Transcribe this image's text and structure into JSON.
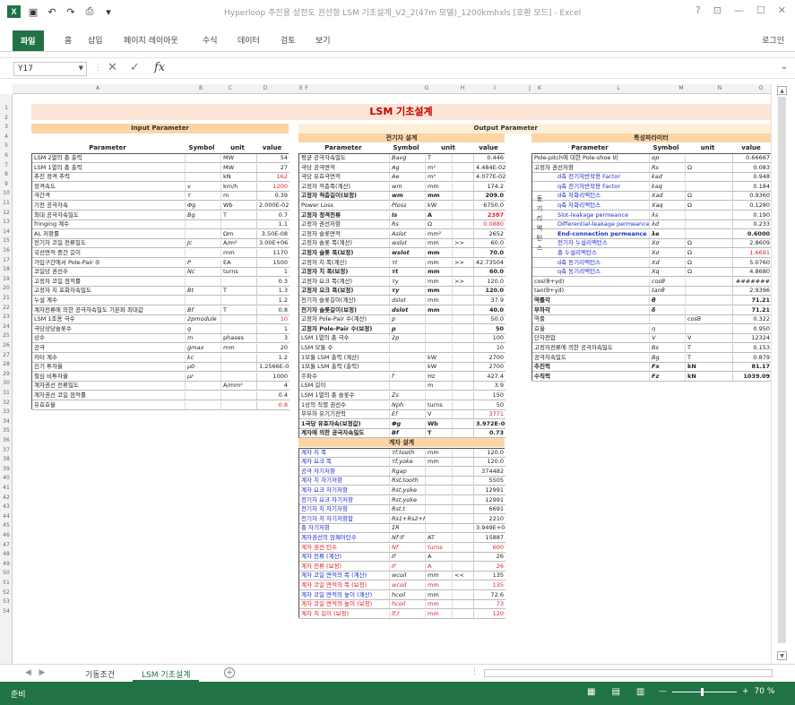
{
  "window": {
    "title": "Hyperloop 추진용 상전도 권선형 LSM 기초설계_V2_2(47m 모델)_1200kmhxls [호환 모드] - Excel",
    "controls": [
      "?",
      "⊡",
      "—",
      "☐",
      "✕"
    ]
  },
  "quick_access": {
    "icons": [
      "save-icon",
      "undo-icon",
      "redo-icon",
      "print-preview-icon",
      "customize-icon"
    ]
  },
  "ribbon": {
    "tabs": [
      "파일",
      "홈",
      "삽입",
      "페이지 레이아웃",
      "수식",
      "데이터",
      "검토",
      "보기"
    ],
    "login": "로그인"
  },
  "formula_bar": {
    "name_box": "Y17",
    "formula": ""
  },
  "sheet": {
    "col_letters": [
      "A",
      "B",
      "C",
      "D",
      "E",
      "F",
      "G",
      "H",
      "I",
      "J",
      "K",
      "L",
      "M",
      "N",
      "O"
    ],
    "title": "LSM 기초설계",
    "input_header": "Input Parameter",
    "output_header": "Output Parameter",
    "elec_header": "전기자 설계",
    "char_header": "특성파라미터",
    "field_header": "계자 설계",
    "col_heads": {
      "param": "Parameter",
      "symbol": "Symbol",
      "unit": "unit",
      "value": "value"
    },
    "vertical_label": [
      "동",
      "기",
      "리",
      "액",
      "턴",
      "스"
    ],
    "input_rows": [
      [
        "LSM 2열의 총 출력",
        "",
        "MW",
        "54"
      ],
      [
        "LSM 1열의 총 출력",
        "",
        "MW",
        "27"
      ],
      [
        "추진 정격 추력",
        "",
        "kN",
        "162"
      ],
      [
        "정격속도",
        "v",
        "km/h",
        "1200"
      ],
      [
        "극간격",
        "τ",
        "m",
        "0.39"
      ],
      [
        "기전 공극자속",
        "Φg",
        "Wb",
        "2.000E-02"
      ],
      [
        "최대 공극자속밀도",
        "Bg",
        "T",
        "0.7"
      ],
      [
        "fringing 계수",
        "",
        "",
        "1.1"
      ],
      [
        "AL 저항률",
        "",
        "Ωm",
        "3.50E-08"
      ],
      [
        "전기자 코일 전류밀도",
        "Jc",
        "A/m²",
        "3.00E+06"
      ],
      [
        "국선면적 중간 길이",
        "",
        "mm",
        "1170"
      ],
      [
        "가입구간에서 Pole-Pair 수",
        "P",
        "EA",
        "1500"
      ],
      [
        "코일당 권선수",
        "Nc",
        "turns",
        "1"
      ],
      [
        "고정자 코일 점적률",
        "",
        "",
        "0.3"
      ],
      [
        "고정자 치 포화자속밀도",
        "Bt",
        "T",
        "1.3"
      ],
      [
        "누설 계수",
        "",
        "",
        "1.2"
      ],
      [
        "계자전류에 의한 공극자속밀도 기본파 최대값",
        "Bf",
        "T",
        "0.8"
      ],
      [
        "LSM 1조용 극수",
        "2pmodule",
        "",
        "10"
      ],
      [
        "극당상당슬롯수",
        "q",
        "",
        "1"
      ],
      [
        "상수",
        "m",
        "phases",
        "3"
      ],
      [
        "공극",
        "gmax",
        "mm",
        "20"
      ],
      [
        "카터 계수",
        "kc",
        "",
        "1.2"
      ],
      [
        "진기 투자율",
        "μ0",
        "",
        "1.2566E-06"
      ],
      [
        "철심 비투자율",
        "μr",
        "",
        "1000"
      ],
      [
        "계자권선 전류밀도",
        "",
        "A/mm²",
        "4"
      ],
      [
        "계자권선 코일 점적률",
        "",
        "",
        "0.4"
      ],
      [
        "유효효율",
        "",
        "",
        "0.8"
      ]
    ],
    "input_red_rows": [
      2,
      3,
      17,
      26
    ],
    "output_rows": [
      [
        "평균 공극자속밀도",
        "Bavg",
        "T",
        "",
        "0.446"
      ],
      [
        "극당 공극면적",
        "Ag",
        "m²",
        "",
        "4.484E-02"
      ],
      [
        "극당 유효극면적",
        "Ae",
        "m²",
        "",
        "4.077E-02"
      ],
      [
        "고정자 적층폭(계산)",
        "wm",
        "mm",
        "",
        "174.2"
      ],
      [
        "고정자 적층길이(보정)",
        "wm",
        "mm",
        "",
        "209.0"
      ],
      [
        "Power Loss",
        "Ploss",
        "kW",
        "",
        "6750.0"
      ],
      [
        "고정자 정격전류",
        "Is",
        "A",
        "",
        "2387"
      ],
      [
        "고정자 권선저항",
        "Rs",
        "Ω",
        "",
        "0.0880"
      ],
      [
        "고정자 슬롯면적",
        "Aslot",
        "mm²",
        "",
        "2652"
      ],
      [
        "고정자 슬롯 폭(계산)",
        "wslot",
        "mm",
        ">>",
        "60.0"
      ],
      [
        "고정자 슬롯 폭(보정)",
        "wslot",
        "mm",
        "",
        "70.0"
      ],
      [
        "고정자 치 폭(계산)",
        "τt",
        "mm",
        ">>",
        "42.73504"
      ],
      [
        "고정자 치 폭(보정)",
        "τt",
        "mm",
        "",
        "60.0"
      ],
      [
        "고정자 요크 폭(계산)",
        "τy",
        "mm",
        ">>",
        "120.0"
      ],
      [
        "고정자 요크 폭(보정)",
        "τy",
        "mm",
        "",
        "120.0"
      ],
      [
        "전기자 슬롯길이(계산)",
        "dslot",
        "mm",
        "",
        "37.9"
      ],
      [
        "전기자 슬롯길이(보정)",
        "dslot",
        "mm",
        "",
        "40.0"
      ],
      [
        "고정자 Pole-Pair 수(계산)",
        "p",
        "",
        "",
        "50.0"
      ],
      [
        "고정자 Pole-Pair 수(보정)",
        "p",
        "",
        "",
        "50"
      ],
      [
        "LSM 1열의 총 극수",
        "2p",
        "",
        "",
        "100"
      ],
      [
        "LSM 모듈 수",
        "",
        "",
        "",
        "10"
      ],
      [
        "1모듈 LSM 출력 (계산)",
        "",
        "kW",
        "",
        "2700"
      ],
      [
        "1모듈 LSM 출력 (출력)",
        "",
        "kW",
        "",
        "2700"
      ],
      [
        "주파수",
        "f",
        "Hz",
        "",
        "427.4"
      ],
      [
        "LSM 길이",
        "",
        "m",
        "",
        "3.9"
      ],
      [
        "LSM 1열의 총 슬롯수",
        "Zs",
        "",
        "",
        "150"
      ],
      [
        "1상의 직렬 권선수",
        "Nph",
        "turns",
        "",
        "50"
      ],
      [
        "무부하 유기기전력",
        "Ef",
        "V",
        "",
        "3771"
      ],
      [
        "1극당 유효자속(보정값)",
        "Φg",
        "Wb",
        "",
        "3.972E-02"
      ],
      [
        "계자에 의한 공극자속밀도",
        "Bf",
        "T",
        "",
        "0.73"
      ]
    ],
    "output_bold_rows": [
      4,
      6,
      10,
      12,
      14,
      16,
      18,
      28,
      29
    ],
    "output_red_rows": [
      6,
      7,
      27
    ],
    "field_rows": [
      [
        "계자 치 폭",
        "τf,tooth",
        "mm",
        "",
        "120.0"
      ],
      [
        "계자 요크 폭",
        "τf,yoke",
        "mm",
        "",
        "120.0"
      ],
      [
        "공극 자기저항",
        "Rgap",
        "",
        "",
        "374482"
      ],
      [
        "계자 치 자기저항",
        "Rst,tooth",
        "",
        "",
        "5505"
      ],
      [
        "계자 요크 자기저항",
        "Rst,yoke",
        "",
        "",
        "12991"
      ],
      [
        "전기자 요크 자기저항",
        "Rst,yoke",
        "",
        "",
        "12991"
      ],
      [
        "전기자 치 자기저항",
        "Rst,t",
        "",
        "",
        "6691"
      ],
      [
        "전기자 치 자기저항합",
        "Rs1+Rs2+Rs3",
        "",
        "",
        "2210"
      ],
      [
        "총 자기저항",
        "ΣR",
        "",
        "",
        "3.949E+05"
      ],
      [
        "계자권선의 암페어턴수",
        "Nf·If",
        "AT",
        "",
        "15887"
      ],
      [
        "계자 권선 턴수",
        "Nf",
        "turns",
        "",
        "600"
      ],
      [
        "계자 전류 (계산)",
        "If",
        "A",
        "",
        "26"
      ],
      [
        "계자 전류 (보정)",
        "If",
        "A",
        "",
        "26"
      ],
      [
        "계자 코일 면적의 폭 (계산)",
        "wcoil",
        "mm",
        "<<",
        "135"
      ],
      [
        "계자 코일 면적의 폭 (보정)",
        "wcoil",
        "mm",
        "",
        "135"
      ],
      [
        "계자 코일 면적의 높이 (계산)",
        "hcoil",
        "mm",
        "",
        "72.6"
      ],
      [
        "계자 코일 면적의 높이 (보정)",
        "hcoil",
        "mm",
        "",
        "73"
      ],
      [
        "계자 치 길이 (보정)",
        "lf,t",
        "mm",
        "",
        "120"
      ]
    ],
    "field_red_rows": [
      10,
      12,
      14,
      16,
      17
    ],
    "char_rows": [
      [
        "Pole-pitch에 대한 Pole-shoe 비",
        "αp",
        "",
        "0.66667"
      ],
      [
        "고정자 권선저항",
        "Rs",
        "Ω",
        "0.083"
      ],
      [
        "d축 전기자반작용 Factor",
        "kad",
        "",
        "0.948"
      ],
      [
        "q축 전기자반작용 Factor",
        "kaq",
        "",
        "0.184"
      ],
      [
        "d축 자화리액턴스",
        "Xad",
        "Ω",
        "0.9360"
      ],
      [
        "q축 자화리액턴스",
        "Xaq",
        "Ω",
        "0.1280"
      ],
      [
        "Slot-leakage permeance",
        "λs",
        "",
        "0.190"
      ],
      [
        "Differential-leakage permeance",
        "λd",
        "",
        "0.233"
      ],
      [
        "End-connection permeance",
        "λe",
        "",
        "0.6000"
      ],
      [
        "전기자 누설리액턴스",
        "Xσ",
        "Ω",
        "2.8609"
      ],
      [
        "총 누설리액턴스",
        "Xσ",
        "Ω",
        "1.6691"
      ],
      [
        "d축 동기리액턴스",
        "Xd",
        "Ω",
        "5.0760"
      ],
      [
        "q축 동기리액턴스",
        "Xq",
        "Ω",
        "4.8680"
      ],
      [
        "cos(θ+γd)",
        "cosθ",
        "",
        "#######"
      ],
      [
        "tan(θ+γd)",
        "tanθ",
        "",
        "2.9396"
      ],
      [
        "역률각",
        "θ",
        "",
        "71.21"
      ],
      [
        "부하각",
        "δ",
        "",
        "71.21"
      ],
      [
        "역률",
        "",
        "cosθ",
        "0.322"
      ],
      [
        "효율",
        "η",
        "",
        "0.950"
      ],
      [
        "단자전압",
        "V",
        "V",
        "12324"
      ],
      [
        "고정자전류에 의한 공극자속밀도",
        "Bs",
        "T",
        "0.153"
      ],
      [
        "공극자속밀도",
        "Bg",
        "T",
        "0.879"
      ],
      [
        "추진력",
        "Fx",
        "kN",
        "81.17"
      ],
      [
        "수직력",
        "Fz",
        "kN",
        "1039.09"
      ]
    ],
    "char_bold_rows": [
      8,
      15,
      16,
      22,
      23
    ],
    "char_red_rows": [
      10
    ],
    "char_blue_rows": [
      2,
      3,
      4,
      5,
      6,
      7,
      8,
      9,
      10,
      11,
      12
    ]
  },
  "sheet_tabs": {
    "tabs": [
      "기동조건",
      "LSM 기초설계"
    ],
    "active": 1
  },
  "status": {
    "ready": "준비",
    "zoom": "70 %"
  },
  "colors": {
    "excel_green": "#217346",
    "title_bg": "#fce4d6",
    "header_bg": "#fcd5a3",
    "red": "#e02020",
    "blue": "#1c2fd0"
  }
}
